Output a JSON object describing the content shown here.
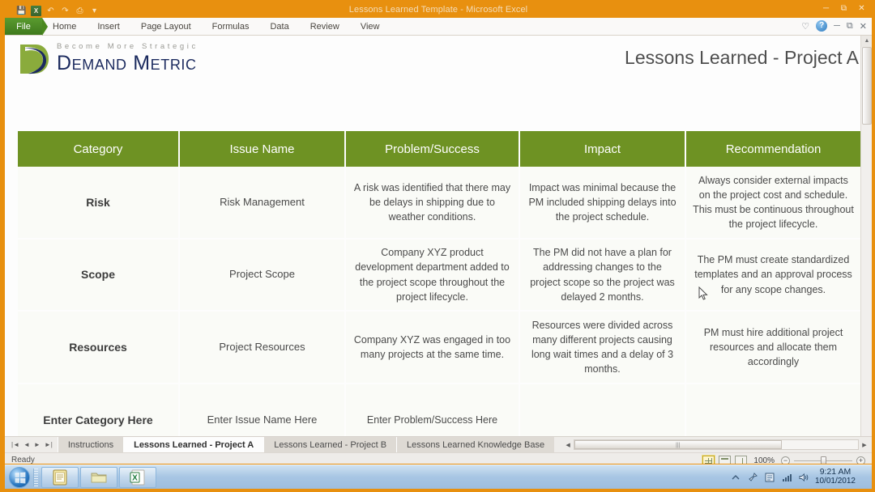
{
  "window": {
    "title": "Lessons Learned Template - Microsoft Excel",
    "quick_access": [
      "excel-icon",
      "save-icon",
      "undo-icon",
      "redo-icon",
      "print-icon",
      "customize-icon"
    ],
    "buttons": [
      "minimize",
      "restore",
      "close"
    ]
  },
  "ribbon": {
    "file_tab": "File",
    "tabs": [
      "Home",
      "Insert",
      "Page Layout",
      "Formulas",
      "Data",
      "Review",
      "View"
    ],
    "right_icons": [
      "ribbon-options-icon",
      "help-icon",
      "minimize-ribbon-icon",
      "restore-window-icon",
      "close-window-icon"
    ],
    "help_label": "?"
  },
  "branding": {
    "tagline": "Become More Strategic",
    "name": "Demand Metric"
  },
  "page": {
    "title": "Lessons Learned - Project A"
  },
  "table": {
    "headers": [
      "Category",
      "Issue Name",
      "Problem/Success",
      "Impact",
      "Recommendation"
    ],
    "rows": [
      {
        "category": "Risk",
        "issue": "Risk Management",
        "problem": "A risk was identified that there may be delays in shipping due to weather conditions.",
        "impact": "Impact was minimal because the PM included shipping delays into the project schedule.",
        "recommendation": "Always consider external impacts on the project cost and schedule. This must be continuous throughout the project lifecycle."
      },
      {
        "category": "Scope",
        "issue": "Project Scope",
        "problem": "Company XYZ product development department added to the project scope throughout the project lifecycle.",
        "impact": "The PM did not have a plan for addressing changes to the project scope so the project was delayed 2 months.",
        "recommendation": "The PM must create standardized templates and an approval process for any scope changes."
      },
      {
        "category": "Resources",
        "issue": "Project Resources",
        "problem": "Company XYZ was engaged in too many projects at the same time.",
        "impact": "Resources were divided across many different projects causing long wait times and a delay of 3 months.",
        "recommendation": "PM must hire additional project resources and allocate them accordingly"
      },
      {
        "category": "Enter Category Here",
        "issue": "Enter Issue Name Here",
        "problem": "Enter Problem/Success Here",
        "impact": "",
        "recommendation": ""
      }
    ]
  },
  "sheet_tabs": {
    "nav_first": "|◄",
    "nav_prev": "◄",
    "nav_next": "►",
    "nav_last": "►|",
    "items": [
      {
        "label": "Instructions",
        "active": false
      },
      {
        "label": "Lessons Learned - Project A",
        "active": true
      },
      {
        "label": "Lessons Learned - Project B",
        "active": false
      },
      {
        "label": "Lessons Learned Knowledge Base",
        "active": false
      }
    ]
  },
  "status_bar": {
    "state": "Ready",
    "view_buttons": [
      "normal-view",
      "page-layout-view",
      "page-break-preview"
    ],
    "zoom": "100%",
    "zoom_out": "−",
    "zoom_in": "+"
  },
  "taskbar": {
    "start_label": "start-orb",
    "items": [
      "notepad-icon",
      "folder-icon",
      "excel-icon"
    ],
    "tray_icons": [
      "show-desktop-icon",
      "show-hidden-icons-icon",
      "network-pin-icon",
      "action-center-icon",
      "signal-icon",
      "volume-icon"
    ],
    "clock_time": "9:21 AM",
    "clock_date": "10/01/2012"
  },
  "colors": {
    "frame_orange": "#e8900f",
    "header_green": "#6e9223",
    "brand_navy": "#1b2a5e",
    "cell_bg": "#fafbf7"
  }
}
